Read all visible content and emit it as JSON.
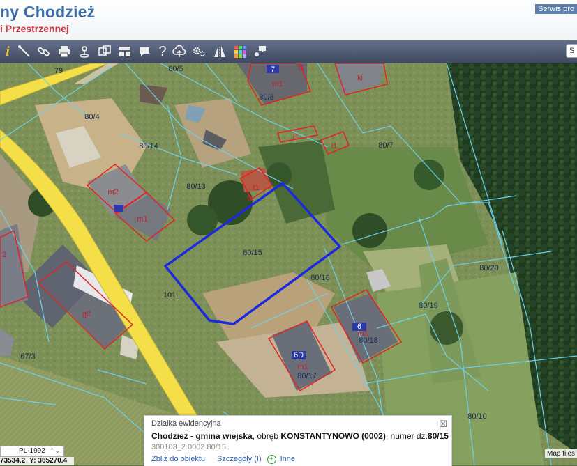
{
  "header": {
    "title_line1": "ny Chodzież",
    "title_line2": "i Przestrzennej",
    "service_link": "Serwis pro"
  },
  "toolbar": {
    "tools": [
      {
        "name": "info-icon",
        "glyph": "i"
      },
      {
        "name": "measure-line-icon"
      },
      {
        "name": "link-icon"
      },
      {
        "name": "print-icon"
      },
      {
        "name": "pin-icon"
      },
      {
        "name": "layers-compare-icon"
      },
      {
        "name": "layout-icon"
      },
      {
        "name": "speech-bubble-icon"
      },
      {
        "name": "help-icon",
        "glyph": "?"
      },
      {
        "name": "cloud-upload-icon"
      },
      {
        "name": "settings-icon"
      },
      {
        "name": "road-icon"
      },
      {
        "name": "color-grid-icon"
      },
      {
        "name": "chat-icon"
      }
    ],
    "search_value": "S"
  },
  "map": {
    "parcels": [
      "80/5",
      "80/6",
      "80/4",
      "80/14",
      "80/13",
      "80/7",
      "80/15",
      "80/16",
      "80/20",
      "80/19",
      "80/18",
      "80/17",
      "80/10",
      "67/3"
    ],
    "buildings": [
      "m1",
      "t1",
      "ki",
      "i1",
      "i1",
      "m2",
      "m1",
      "t1",
      "t1",
      "g2",
      "m1",
      "m1",
      "2",
      "7",
      "6",
      "6D"
    ],
    "roads": [
      "79",
      "101"
    ]
  },
  "popup": {
    "title": "Działka ewidencyjna",
    "main_prefix": "Chodzież - gmina wiejska",
    "main_middle": ", obręb ",
    "main_obreb": "KONSTANTYNOWO (0002)",
    "main_suffix": ", numer dz.",
    "main_number": "80/15",
    "identifier": "300103_2.0002.80/15",
    "link_zoom": "Zbliż do obiektu",
    "link_details": "Szczegóły (I)",
    "link_more": "Inne",
    "close_glyph": "☒"
  },
  "footer": {
    "srs": "PL-1992",
    "x_coord": "73534.2",
    "y_label": "Y:",
    "y_coord": "365270.4",
    "attribution": "Map tiles"
  },
  "colors": {
    "parcel_line": "#6fd0ea",
    "selected_parcel": "#1a2adc",
    "building_outline": "#e22323",
    "road": "#ffe24a",
    "header_title": "#3b6ea8",
    "header_subtitle": "#c8393c"
  }
}
